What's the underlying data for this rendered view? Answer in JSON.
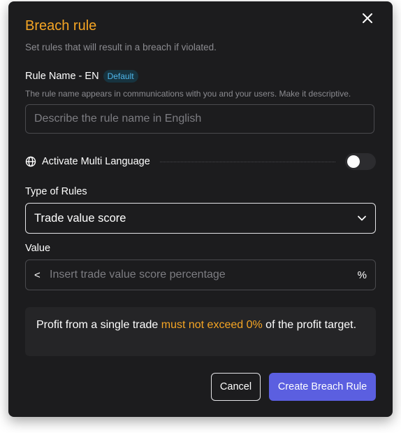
{
  "dialog": {
    "title": "Breach rule",
    "subtitle": "Set rules that will result in a breach if violated.",
    "close_icon": "close-icon",
    "accent_color": "#f5a524"
  },
  "rule_name": {
    "label": "Rule Name - EN",
    "badge": "Default",
    "help": "The rule name appears in communications with you and your users. Make it descriptive.",
    "placeholder": "Describe the rule name in English",
    "value": ""
  },
  "multi_language": {
    "icon": "globe-icon",
    "label": "Activate Multi Language",
    "enabled": false
  },
  "rule_type": {
    "label": "Type of Rules",
    "selected": "Trade value score",
    "icon": "chevron-down-icon"
  },
  "value_field": {
    "label": "Value",
    "prefix": "<",
    "placeholder": "Insert trade value score percentage",
    "suffix": "%",
    "value": ""
  },
  "summary": {
    "before": "Profit from a single trade ",
    "highlight": "must not exceed 0%",
    "after": " of the profit target."
  },
  "actions": {
    "cancel_label": "Cancel",
    "create_label": "Create Breach Rule",
    "primary_color": "#5b5fe0"
  }
}
